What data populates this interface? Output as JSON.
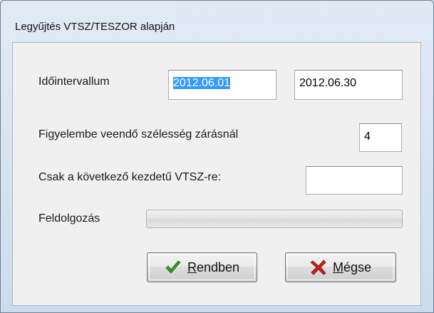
{
  "window": {
    "title": "Legyűjtés VTSZ/TESZOR alapján"
  },
  "form": {
    "interval_label": "Időintervallum",
    "date_from": "2012.06.01",
    "date_to": "2012.06.30",
    "width_label": "Figyelembe veendő szélesség zárásnál",
    "width_value": "4",
    "prefix_label": "Csak a következő kezdetű VTSZ-re:",
    "prefix_value": "",
    "processing_label": "Feldolgozás",
    "progress_fraction": 0
  },
  "buttons": {
    "ok_label": "Rendben",
    "ok_icon": "check-icon",
    "cancel_label": "Mégse",
    "cancel_icon": "x-icon"
  },
  "colors": {
    "selection": "#3399ff",
    "ok_icon": "#2e9a1f",
    "cancel_icon": "#c8201a"
  }
}
